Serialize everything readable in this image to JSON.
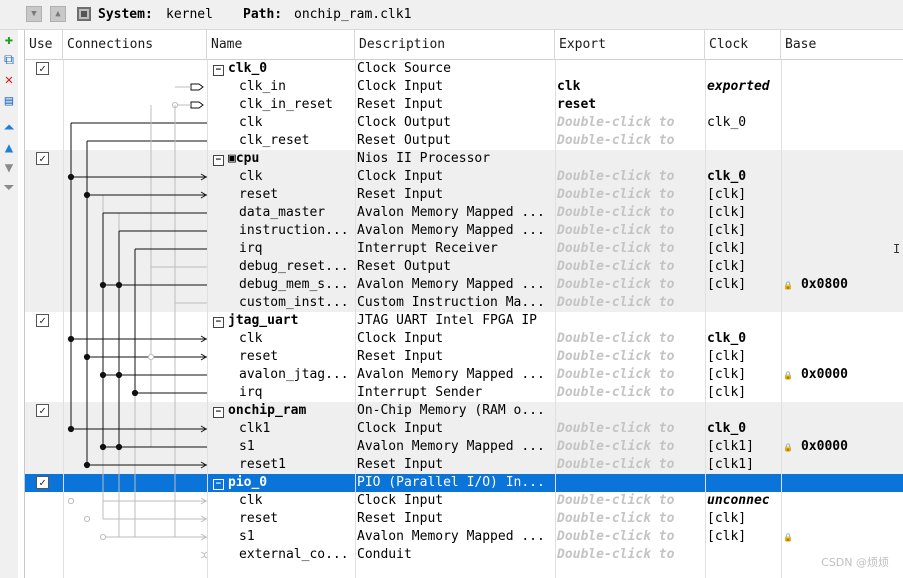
{
  "system": {
    "label": "System:",
    "value": "kernel"
  },
  "path": {
    "label": "Path:",
    "value": "onchip_ram.clk1"
  },
  "columns": [
    "Use",
    "Connections",
    "Name",
    "Description",
    "Export",
    "Clock",
    "Base"
  ],
  "hint_text": "Double-click to",
  "rows": [
    {
      "kind": "module",
      "name": "clk_0",
      "desc": "Clock Source",
      "export": "",
      "clock": "",
      "base": "",
      "checked": true
    },
    {
      "kind": "port",
      "name": "clk_in",
      "desc": "Clock Input",
      "export": "clk",
      "clock": "exported",
      "base": ""
    },
    {
      "kind": "port",
      "name": "clk_in_reset",
      "desc": "Reset Input",
      "export": "reset",
      "clock": "",
      "base": ""
    },
    {
      "kind": "port",
      "name": "clk",
      "desc": "Clock Output",
      "export": "hint",
      "clock": "clk_0",
      "base": ""
    },
    {
      "kind": "port",
      "name": "clk_reset",
      "desc": "Reset Output",
      "export": "hint",
      "clock": "",
      "base": ""
    },
    {
      "kind": "module",
      "name": "cpu",
      "desc": "Nios II Processor",
      "export": "",
      "clock": "",
      "base": "",
      "checked": true,
      "icon": true
    },
    {
      "kind": "port",
      "name": "clk",
      "desc": "Clock Input",
      "export": "hint",
      "clock": "clk_0",
      "base": ""
    },
    {
      "kind": "port",
      "name": "reset",
      "desc": "Reset Input",
      "export": "hint",
      "clock": "[clk]",
      "base": ""
    },
    {
      "kind": "port",
      "name": "data_master",
      "desc": "Avalon Memory Mapped ...",
      "export": "hint",
      "clock": "[clk]",
      "base": ""
    },
    {
      "kind": "port",
      "name": "instruction...",
      "desc": "Avalon Memory Mapped ...",
      "export": "hint",
      "clock": "[clk]",
      "base": ""
    },
    {
      "kind": "port",
      "name": "irq",
      "desc": "Interrupt Receiver",
      "export": "hint",
      "clock": "[clk]",
      "base": ""
    },
    {
      "kind": "port",
      "name": "debug_reset...",
      "desc": "Reset Output",
      "export": "hint",
      "clock": "[clk]",
      "base": ""
    },
    {
      "kind": "port",
      "name": "debug_mem_s...",
      "desc": "Avalon Memory Mapped ...",
      "export": "hint",
      "clock": "[clk]",
      "base": "0x0800"
    },
    {
      "kind": "port",
      "name": "custom_inst...",
      "desc": "Custom Instruction Ma...",
      "export": "hint",
      "clock": "",
      "base": ""
    },
    {
      "kind": "module",
      "name": "jtag_uart",
      "desc": "JTAG UART Intel FPGA IP",
      "export": "",
      "clock": "",
      "base": "",
      "checked": true
    },
    {
      "kind": "port",
      "name": "clk",
      "desc": "Clock Input",
      "export": "hint",
      "clock": "clk_0",
      "base": ""
    },
    {
      "kind": "port",
      "name": "reset",
      "desc": "Reset Input",
      "export": "hint",
      "clock": "[clk]",
      "base": ""
    },
    {
      "kind": "port",
      "name": "avalon_jtag...",
      "desc": "Avalon Memory Mapped ...",
      "export": "hint",
      "clock": "[clk]",
      "base": "0x0000"
    },
    {
      "kind": "port",
      "name": "irq",
      "desc": "Interrupt Sender",
      "export": "hint",
      "clock": "[clk]",
      "base": ""
    },
    {
      "kind": "module",
      "name": "onchip_ram",
      "desc": "On-Chip Memory (RAM o...",
      "export": "",
      "clock": "",
      "base": "",
      "checked": true
    },
    {
      "kind": "port",
      "name": "clk1",
      "desc": "Clock Input",
      "export": "hint",
      "clock": "clk_0",
      "base": ""
    },
    {
      "kind": "port",
      "name": "s1",
      "desc": "Avalon Memory Mapped ...",
      "export": "hint",
      "clock": "[clk1]",
      "base": "0x0000"
    },
    {
      "kind": "port",
      "name": "reset1",
      "desc": "Reset Input",
      "export": "hint",
      "clock": "[clk1]",
      "base": ""
    },
    {
      "kind": "module",
      "name": "pio_0",
      "desc": "PIO (Parallel I/O) In...",
      "export": "",
      "clock": "",
      "base": "",
      "checked": true,
      "selected": true
    },
    {
      "kind": "port",
      "name": "clk",
      "desc": "Clock Input",
      "export": "hint",
      "clock": "unconnec",
      "base": ""
    },
    {
      "kind": "port",
      "name": "reset",
      "desc": "Reset Input",
      "export": "hint",
      "clock": "[clk]",
      "base": ""
    },
    {
      "kind": "port",
      "name": "s1",
      "desc": "Avalon Memory Mapped ...",
      "export": "hint",
      "clock": "[clk]",
      "base": "lock"
    },
    {
      "kind": "port",
      "name": "external_co...",
      "desc": "Conduit",
      "export": "hint",
      "clock": "",
      "base": ""
    }
  ],
  "watermark": "CSDN @烦烦"
}
